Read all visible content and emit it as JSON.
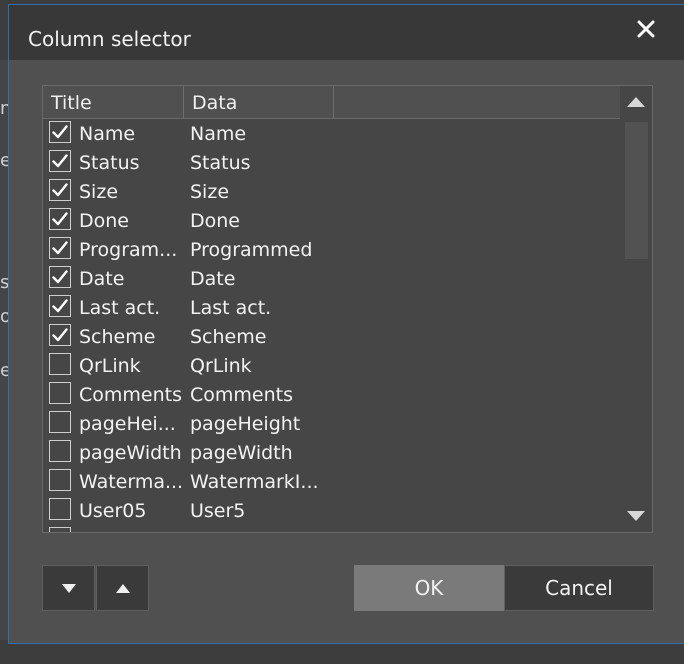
{
  "background": {
    "fragments": [
      "n",
      "e",
      "s",
      "o",
      "e"
    ]
  },
  "dialog": {
    "title": "Column selector",
    "close_icon": "close-icon"
  },
  "grid": {
    "columns": [
      "Title",
      "Data"
    ],
    "rows": [
      {
        "title": "Name",
        "data": "Name",
        "checked": true
      },
      {
        "title": "Status",
        "data": "Status",
        "checked": true
      },
      {
        "title": "Size",
        "data": "Size",
        "checked": true
      },
      {
        "title": "Done",
        "data": "Done",
        "checked": true
      },
      {
        "title": "Program...",
        "data": "Programmed",
        "checked": true
      },
      {
        "title": "Date",
        "data": "Date",
        "checked": true
      },
      {
        "title": "Last act.",
        "data": "Last act.",
        "checked": true
      },
      {
        "title": "Scheme",
        "data": "Scheme",
        "checked": true
      },
      {
        "title": "QrLink",
        "data": "QrLink",
        "checked": false
      },
      {
        "title": "Comments",
        "data": "Comments",
        "checked": false
      },
      {
        "title": "pageHei...",
        "data": "pageHeight",
        "checked": false
      },
      {
        "title": "pageWidth",
        "data": "pageWidth",
        "checked": false
      },
      {
        "title": "Waterma...",
        "data": "WatermarkI...",
        "checked": false
      },
      {
        "title": "User05",
        "data": "User5",
        "checked": false
      }
    ]
  },
  "buttons": {
    "ok": "OK",
    "cancel": "Cancel"
  },
  "colors": {
    "accent_border": "#2f6fb0",
    "dialog_bg": "#505050",
    "titlebar_bg": "#383838"
  }
}
